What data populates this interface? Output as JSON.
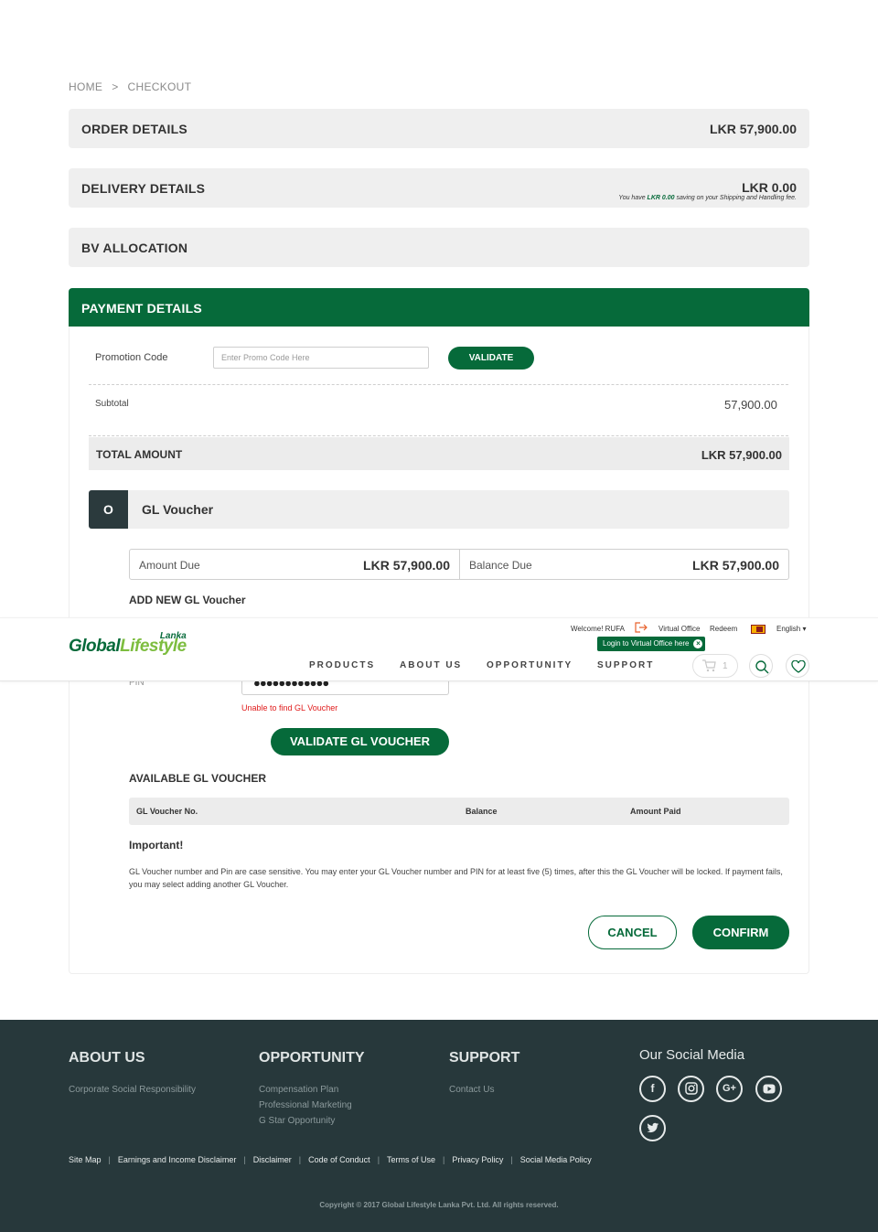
{
  "breadcrumb": {
    "home": "HOME",
    "sep": ">",
    "current": "CHECKOUT"
  },
  "order": {
    "title": "ORDER DETAILS",
    "amount": "LKR 57,900.00"
  },
  "delivery": {
    "title": "DELIVERY DETAILS",
    "amount": "LKR 0.00",
    "note_pre": "You have ",
    "note_value": "LKR 0.00",
    "note_post": " saving on your Shipping and Handling fee."
  },
  "bv": {
    "title": "BV ALLOCATION"
  },
  "payment": {
    "title": "PAYMENT DETAILS",
    "promo_label": "Promotion Code",
    "promo_placeholder": "Enter Promo Code Here",
    "validate_label": "VALIDATE",
    "subtotal_label": "Subtotal",
    "subtotal_value": "57,900.00",
    "total_label": "TOTAL AMOUNT",
    "total_value": "LKR 57,900.00"
  },
  "voucher": {
    "radio": "O",
    "title": "GL Voucher",
    "amount_due_label": "Amount Due",
    "amount_due_value": "LKR 57,900.00",
    "balance_due_label": "Balance Due",
    "balance_due_value": "LKR 57,900.00",
    "add_new": "ADD NEW GL Voucher",
    "pin_label": "PIN",
    "pin_value": "●●●●●●●●●●●●",
    "error": "Unable to find GL Voucher",
    "validate_gl": "VALIDATE GL VOUCHER",
    "available_title": "AVAILABLE GL VOUCHER",
    "table_headers": [
      "GL Voucher No.",
      "Balance",
      "Amount Paid"
    ],
    "important_title": "Important!",
    "important_text": "GL Voucher number and Pin are case sensitive. You may enter your GL Voucher number and PIN for at least five (5) times, after this the GL Voucher will be locked. If payment fails, you may select adding another GL Voucher.",
    "cancel": "CANCEL",
    "confirm": "CONFIRM"
  },
  "header": {
    "logo_main_a": "Global",
    "logo_main_b": "Lifestyle",
    "logo_sub": "Lanka",
    "welcome": "Welcome! RUFA",
    "logout_icon": "logout-icon",
    "virtual_office": "Virtual Office",
    "redeem": "Redeem",
    "language": "English",
    "tooltip": "Login to Virtual Office here",
    "nav": [
      "PRODUCTS",
      "ABOUT US",
      "OPPORTUNITY",
      "SUPPORT"
    ],
    "cart_count": "1"
  },
  "footer": {
    "about_title": "ABOUT US",
    "about_links": [
      "Corporate Social Responsibility"
    ],
    "opp_title": "OPPORTUNITY",
    "opp_links": [
      "Compensation Plan",
      "Professional Marketing",
      "G Star Opportunity"
    ],
    "support_title": "SUPPORT",
    "support_links": [
      "Contact Us"
    ],
    "social_title": "Our Social Media",
    "bottom_links": [
      "Site Map",
      "Earnings and Income Disclaimer",
      "Disclaimer",
      "Code of Conduct",
      "Terms of Use",
      "Privacy Policy",
      "Social Media Policy"
    ],
    "copyright": "Copyright © 2017 Global Lifestyle Lanka Pvt. Ltd. All rights reserved."
  },
  "colors": {
    "brand_green": "#066a3a",
    "footer_bg": "#27383b",
    "error_red": "#e01b1b"
  }
}
